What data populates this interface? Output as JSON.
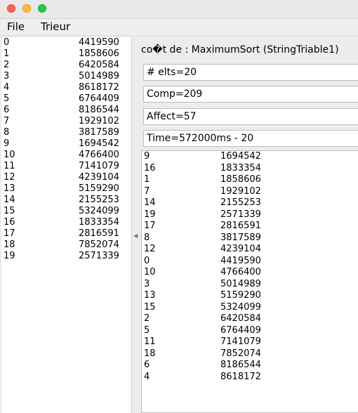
{
  "window": {
    "controls": [
      "close",
      "minimize",
      "zoom"
    ],
    "colors": {
      "close": "#fe5f57",
      "minimize": "#febc2e",
      "zoom": "#28c840"
    }
  },
  "menu": {
    "file": "File",
    "trieur": "Trieur"
  },
  "input_list": [
    {
      "index": "0",
      "value": "4419590"
    },
    {
      "index": "1",
      "value": "1858606"
    },
    {
      "index": "2",
      "value": "6420584"
    },
    {
      "index": "3",
      "value": "5014989"
    },
    {
      "index": "4",
      "value": "8618172"
    },
    {
      "index": "5",
      "value": "6764409"
    },
    {
      "index": "6",
      "value": "8186544"
    },
    {
      "index": "7",
      "value": "1929102"
    },
    {
      "index": "8",
      "value": "3817589"
    },
    {
      "index": "9",
      "value": "1694542"
    },
    {
      "index": "10",
      "value": "4766400"
    },
    {
      "index": "11",
      "value": "7141079"
    },
    {
      "index": "12",
      "value": "4239104"
    },
    {
      "index": "13",
      "value": "5159290"
    },
    {
      "index": "14",
      "value": "2155253"
    },
    {
      "index": "15",
      "value": "5324099"
    },
    {
      "index": "16",
      "value": "1833354"
    },
    {
      "index": "17",
      "value": "2816591"
    },
    {
      "index": "18",
      "value": "7852074"
    },
    {
      "index": "19",
      "value": "2571339"
    }
  ],
  "results": {
    "heading": "co�t de : MaximumSort (StringTriable1)",
    "elements": "# elts=20",
    "comparisons": "Comp=209",
    "assignments": "Affect=57",
    "time": "Time=572000ms - 20"
  },
  "sorted_list": [
    {
      "index": "9",
      "value": "1694542"
    },
    {
      "index": "16",
      "value": "1833354"
    },
    {
      "index": "1",
      "value": "1858606"
    },
    {
      "index": "7",
      "value": "1929102"
    },
    {
      "index": "14",
      "value": "2155253"
    },
    {
      "index": "19",
      "value": "2571339"
    },
    {
      "index": "17",
      "value": "2816591"
    },
    {
      "index": "8",
      "value": "3817589"
    },
    {
      "index": "12",
      "value": "4239104"
    },
    {
      "index": "0",
      "value": "4419590"
    },
    {
      "index": "10",
      "value": "4766400"
    },
    {
      "index": "3",
      "value": "5014989"
    },
    {
      "index": "13",
      "value": "5159290"
    },
    {
      "index": "15",
      "value": "5324099"
    },
    {
      "index": "2",
      "value": "6420584"
    },
    {
      "index": "5",
      "value": "6764409"
    },
    {
      "index": "11",
      "value": "7141079"
    },
    {
      "index": "18",
      "value": "7852074"
    },
    {
      "index": "6",
      "value": "8186544"
    },
    {
      "index": "4",
      "value": "8618172"
    }
  ]
}
